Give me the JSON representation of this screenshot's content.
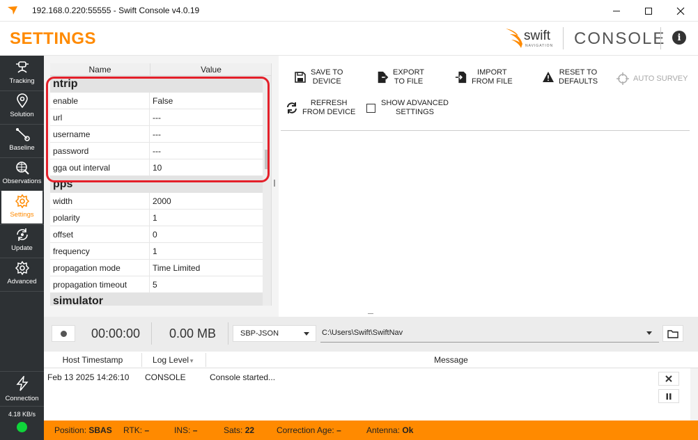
{
  "window": {
    "title": "192.168.0.220:55555 - Swift Console v4.0.19"
  },
  "header": {
    "page_title": "SETTINGS",
    "logo_text": "swift",
    "logo_subtext": "NAVIGATION",
    "console_word": "CONSOLE",
    "info_glyph": "i"
  },
  "sidebar": {
    "items": [
      {
        "label": "Tracking",
        "icon": "tracking-icon"
      },
      {
        "label": "Solution",
        "icon": "location-pin-icon"
      },
      {
        "label": "Baseline",
        "icon": "baseline-icon"
      },
      {
        "label": "Observations",
        "icon": "globe-icon"
      },
      {
        "label": "Settings",
        "icon": "gear-icon",
        "active": true
      },
      {
        "label": "Update",
        "icon": "update-icon"
      },
      {
        "label": "Advanced",
        "icon": "advanced-gear-icon"
      }
    ],
    "connection_label": "Connection",
    "data_rate": "4.18 KB/s",
    "status_led_color": "#0fd43a"
  },
  "settings_table": {
    "columns": [
      "Name",
      "Value"
    ],
    "groups": [
      {
        "name": "ntrip",
        "rows": [
          {
            "name": "enable",
            "value": "False"
          },
          {
            "name": "url",
            "value": "---"
          },
          {
            "name": "username",
            "value": "---"
          },
          {
            "name": "password",
            "value": "---"
          },
          {
            "name": "gga out interval",
            "value": "10"
          }
        ]
      },
      {
        "name": "pps",
        "rows": [
          {
            "name": "width",
            "value": "2000"
          },
          {
            "name": "polarity",
            "value": "1"
          },
          {
            "name": "offset",
            "value": "0"
          },
          {
            "name": "frequency",
            "value": "1"
          },
          {
            "name": "propagation mode",
            "value": "Time Limited"
          },
          {
            "name": "propagation timeout",
            "value": "5"
          }
        ]
      },
      {
        "name": "simulator",
        "rows": []
      }
    ],
    "highlight_color": "#e4202a"
  },
  "toolbar": {
    "save": "SAVE TO\nDEVICE",
    "export": "EXPORT\nTO FILE",
    "import": "IMPORT\nFROM FILE",
    "reset": "RESET TO\nDEFAULTS",
    "auto_survey": "AUTO SURVEY",
    "refresh": "REFRESH\nFROM DEVICE",
    "show_advanced": "SHOW ADVANCED\nSETTINGS"
  },
  "recording": {
    "elapsed": "00:00:00",
    "size": "0.00 MB",
    "format": "SBP-JSON",
    "path": "C:\\Users\\Swift\\SwiftNav"
  },
  "log": {
    "columns": [
      "Host Timestamp",
      "Log Level",
      "Message"
    ],
    "rows": [
      {
        "timestamp": "Feb 13 2025 14:26:10",
        "level": "CONSOLE",
        "message": "Console started..."
      }
    ]
  },
  "status_bar": {
    "position_label": "Position:",
    "position_value": "SBAS",
    "rtk_label": "RTK:",
    "rtk_value": "–",
    "ins_label": "INS:",
    "ins_value": "–",
    "sats_label": "Sats:",
    "sats_value": "22",
    "corr_label": "Correction Age:",
    "corr_value": "–",
    "antenna_label": "Antenna:",
    "antenna_value": "Ok",
    "color": "#ff8a00"
  },
  "colors": {
    "accent": "#ff8a00",
    "sidebar_bg": "#2d3134"
  }
}
